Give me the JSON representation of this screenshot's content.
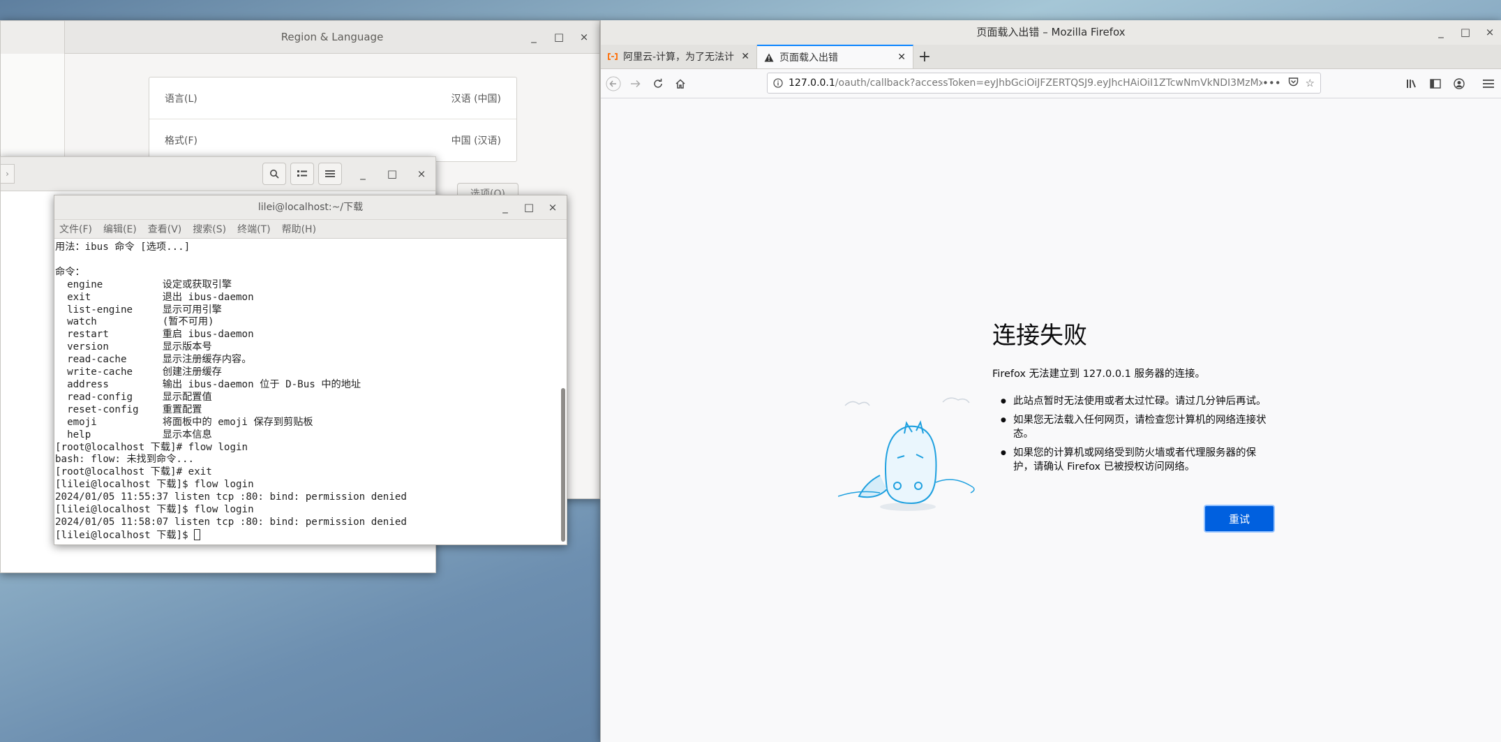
{
  "colors": {
    "firefox_accent": "#0060df",
    "tab_active_border": "#0a84ff",
    "desktop": "#7c9dbc"
  },
  "region_window": {
    "title": "Region & Language",
    "rows": [
      {
        "label": "语言(L)",
        "value": "汉语 (中国)"
      },
      {
        "label": "格式(F)",
        "value": "中国 (汉语)"
      }
    ],
    "options_button": "选项(O)"
  },
  "files_window": {},
  "terminal": {
    "title": "lilei@localhost:~/下载",
    "menu": [
      "文件(F)",
      "编辑(E)",
      "查看(V)",
      "搜索(S)",
      "终端(T)",
      "帮助(H)"
    ],
    "lines": [
      "用法：ibus 命令 [选项...]",
      "",
      "命令：",
      "  engine          设定或获取引擎",
      "  exit            退出 ibus-daemon",
      "  list-engine     显示可用引擎",
      "  watch           (暂不可用)",
      "  restart         重启 ibus-daemon",
      "  version         显示版本号",
      "  read-cache      显示注册缓存内容。",
      "  write-cache     创建注册缓存",
      "  address         输出 ibus-daemon 位于 D-Bus 中的地址",
      "  read-config     显示配置值",
      "  reset-config    重置配置",
      "  emoji           将面板中的 emoji 保存到剪贴板",
      "  help            显示本信息",
      "[root@localhost 下载]# flow login",
      "bash: flow: 未找到命令...",
      "[root@localhost 下载]# exit",
      "[lilei@localhost 下载]$ flow login",
      "2024/01/05 11:55:37 listen tcp :80: bind: permission denied",
      "[lilei@localhost 下载]$ flow login",
      "2024/01/05 11:58:07 listen tcp :80: bind: permission denied"
    ],
    "prompt": "[lilei@localhost 下载]$ "
  },
  "firefox": {
    "window_title": "页面载入出错 – Mozilla Firefox",
    "tabs": [
      {
        "label": "阿里云-计算，为了无法计",
        "icon": "aliyun-icon",
        "active": false
      },
      {
        "label": "页面载入出错",
        "icon": "warning-icon",
        "active": true
      }
    ],
    "url_host": "127.0.0.1",
    "url_rest": "/oauth/callback?accessToken=eyJhbGciOiJFZERTQSJ9.eyJhcHAiOiI1ZTcwNmVkNDI3MzMx",
    "error": {
      "title": "连接失败",
      "description": "Firefox 无法建立到 127.0.0.1 服务器的连接。",
      "bullets": [
        "此站点暂时无法使用或者太过忙碌。请过几分钟后再试。",
        "如果您无法载入任何网页，请检查您计算机的网络连接状态。",
        "如果您的计算机或网络受到防火墙或者代理服务器的保护，请确认 Firefox 已被授权访问网络。"
      ],
      "retry_label": "重试"
    }
  }
}
